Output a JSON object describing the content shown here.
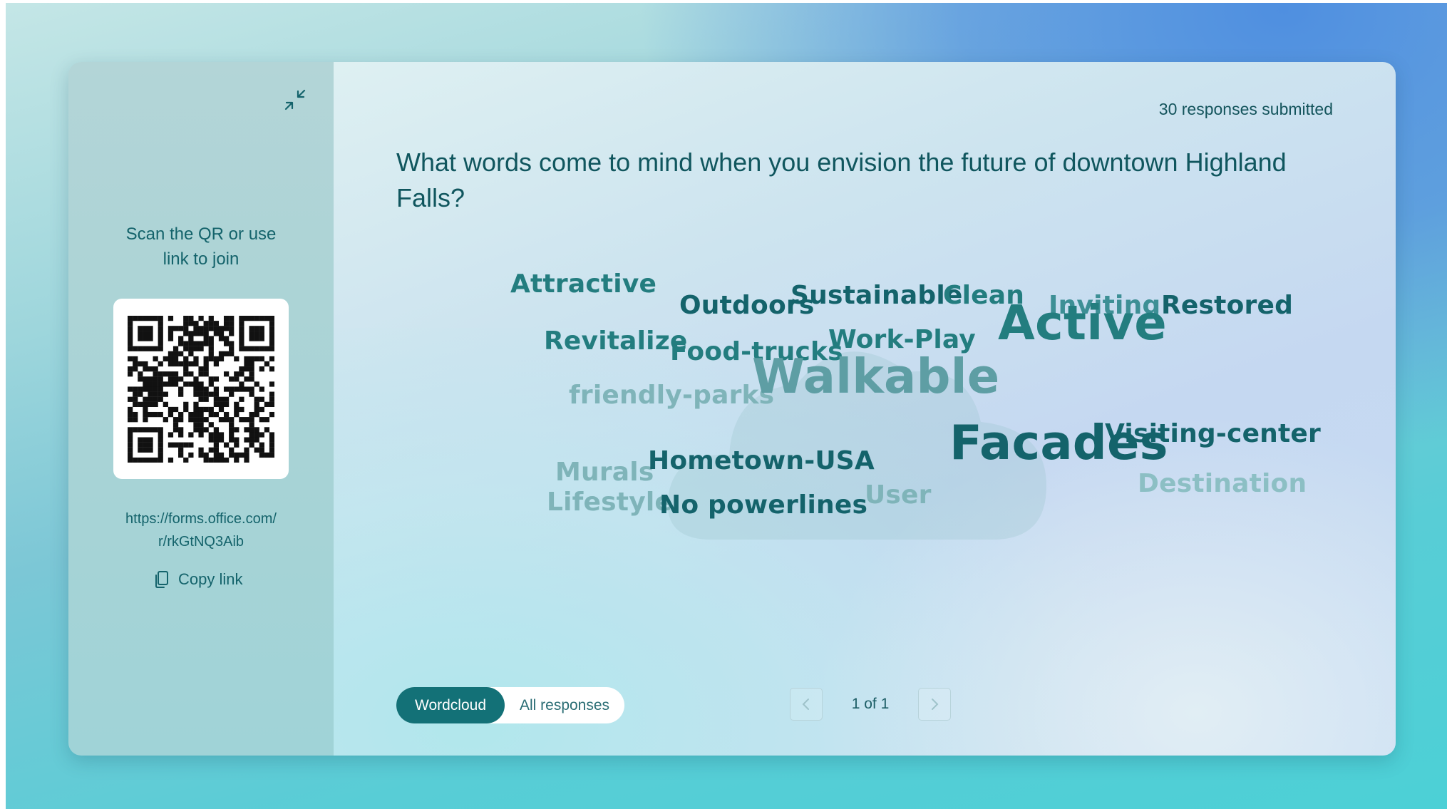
{
  "sidebar": {
    "join_prompt_line1": "Scan the QR or use",
    "join_prompt_line2": "link to join",
    "join_url_line1": "https://forms.office.com/",
    "join_url_line2": "r/rkGtNQ3Aib",
    "copy_link_label": "Copy link",
    "collapse_icon": "collapse-arrows-icon",
    "copy_icon": "copy-icon"
  },
  "header": {
    "responses_submitted": "30 responses submitted",
    "question": "What words come to mind when you envision the future of downtown Highland Falls?"
  },
  "wordcloud": {
    "words": [
      {
        "text": "Attractive",
        "color": "#237d7f"
      },
      {
        "text": "Outdoors",
        "color": "#14636b"
      },
      {
        "text": "Sustainable",
        "color": "#14636b"
      },
      {
        "text": "Clean",
        "color": "#237d7f"
      },
      {
        "text": "Inviting",
        "color": "#3d8f95"
      },
      {
        "text": "Restored",
        "color": "#14636b"
      },
      {
        "text": "Revitalize",
        "color": "#237d7f"
      },
      {
        "text": "Food-trucks",
        "color": "#237d7f"
      },
      {
        "text": "Work-Play",
        "color": "#237d7f"
      },
      {
        "text": "Active",
        "color": "#237d7f"
      },
      {
        "text": "friendly-parks",
        "color": "#7fb4b9"
      },
      {
        "text": "Walkable",
        "color": "#5e9ea4"
      },
      {
        "text": "Visiting-center",
        "color": "#14636b"
      },
      {
        "text": "Murals",
        "color": "#7fb4b9"
      },
      {
        "text": "Hometown-USA",
        "color": "#14636b"
      },
      {
        "text": "User",
        "color": "#7fb4b9"
      },
      {
        "text": "Facades",
        "color": "#14636b"
      },
      {
        "text": "Destination",
        "color": "#8cbfc4"
      },
      {
        "text": "Lifestyle",
        "color": "#7fb4b9"
      },
      {
        "text": "No powerlines",
        "color": "#14636b"
      }
    ]
  },
  "footer": {
    "tabs": [
      {
        "label": "Wordcloud",
        "active": true
      },
      {
        "label": "All responses",
        "active": false
      }
    ],
    "pager_text": "1 of 1",
    "prev_icon": "chevron-left-icon",
    "next_icon": "chevron-right-icon"
  }
}
